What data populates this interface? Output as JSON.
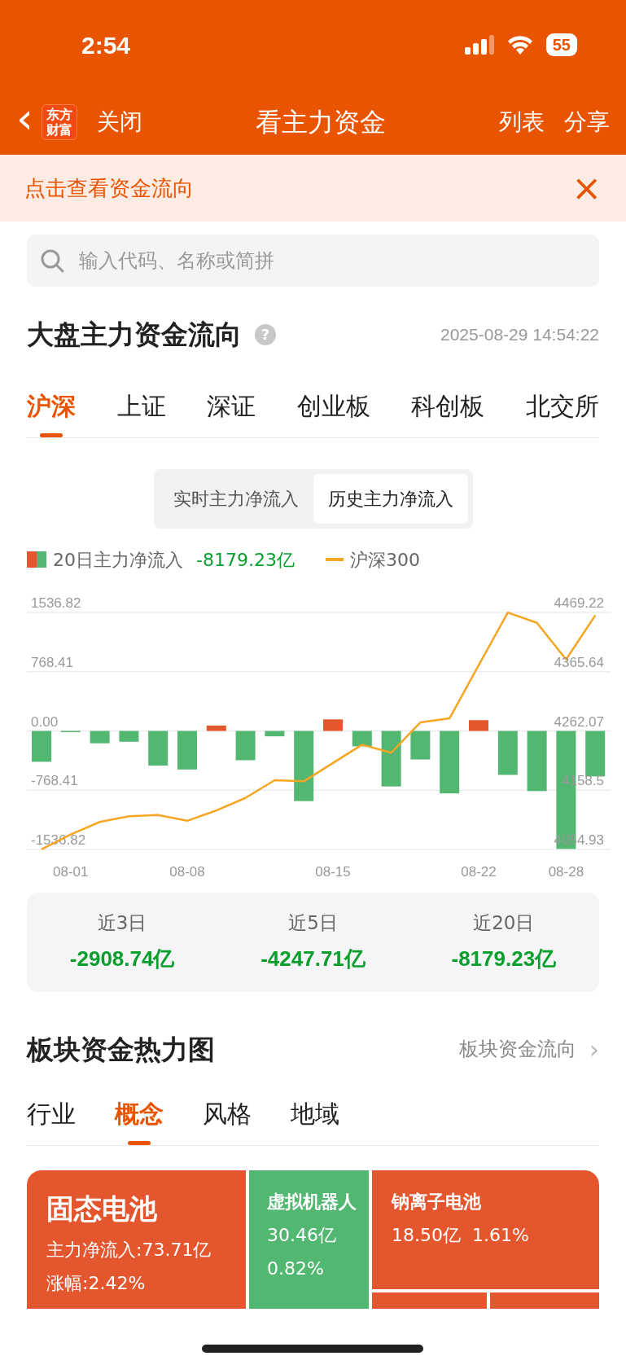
{
  "status_bar": {
    "time": "2:54",
    "battery": "55"
  },
  "nav": {
    "back": "‹",
    "logo": [
      "东方",
      "财富"
    ],
    "close": "关闭",
    "title": "看主力资金",
    "list": "列表",
    "share": "分享"
  },
  "banner": {
    "text": "点击查看资金流向",
    "close": "×"
  },
  "search": {
    "placeholder": "输入代码、名称或简拼"
  },
  "market_flow": {
    "title": "大盘主力资金流向",
    "help": "?",
    "timestamp": "2025-08-29 14:54:22",
    "tabs": [
      {
        "label": "沪深",
        "selected": true
      },
      {
        "label": "上证",
        "selected": false
      },
      {
        "label": "深证",
        "selected": false
      },
      {
        "label": "创业板",
        "selected": false
      },
      {
        "label": "科创板",
        "selected": false
      },
      {
        "label": "北交所",
        "selected": false
      }
    ],
    "modes": [
      {
        "label": "实时主力净流入",
        "selected": false
      },
      {
        "label": "历史主力净流入",
        "selected": true
      }
    ],
    "legend": {
      "bars_value": "-8179.23亿"
    },
    "chart_data": {
      "type": "bar",
      "grid": true,
      "categories": [
        null,
        "08-01",
        null,
        null,
        null,
        "08-08",
        null,
        null,
        null,
        null,
        "08-15",
        null,
        null,
        null,
        null,
        "08-22",
        null,
        null,
        "08-28",
        null
      ],
      "series": [
        {
          "name": "20日主力净流入",
          "values": [
            -400,
            -10,
            -160,
            -140,
            -450,
            -500,
            70,
            -380,
            -70,
            -910,
            150,
            -200,
            -720,
            -370,
            -810,
            140,
            -570,
            -780,
            -1530,
            -590
          ]
        }
      ],
      "ylim": [
        -1536.82,
        1536.82
      ],
      "yticks": [
        {
          "value": 1536.82,
          "label": "1536.82"
        },
        {
          "value": 768.41,
          "label": "768.41"
        },
        {
          "value": 0,
          "label": "0.00"
        },
        {
          "value": -768.41,
          "label": "-768.41"
        },
        {
          "value": -1536.82,
          "label": "-1536.82"
        }
      ]
    },
    "index_overlay": {
      "chart_data": {
        "type": "line",
        "categories": [
          null,
          null,
          null,
          null,
          null,
          null,
          null,
          null,
          null,
          null,
          null,
          null,
          null,
          null,
          null,
          null,
          null,
          null,
          null,
          null
        ],
        "series": [
          {
            "name": "沪深300",
            "color": "#f5a623",
            "values": [
              4055,
              4081,
              4103,
              4113,
              4115,
              4105,
              4123,
              4145,
              4176,
              4174,
              4206,
              4238,
              4224,
              4277,
              4284,
              4377,
              4469,
              4451,
              4387,
              4464
            ]
          }
        ],
        "ylim": [
          4054.93,
          4469.22
        ],
        "yticks": [
          {
            "value": 4469.22,
            "label": "4469.22"
          },
          {
            "value": 4365.64,
            "label": "4365.64"
          },
          {
            "value": 4262.07,
            "label": "4262.07"
          },
          {
            "value": 4158.5,
            "label": "4158.5"
          },
          {
            "value": 4054.93,
            "label": "4054.93"
          }
        ]
      }
    },
    "summary": [
      {
        "label": "近3日",
        "value": "-2908.74亿"
      },
      {
        "label": "近5日",
        "value": "-4247.71亿"
      },
      {
        "label": "近20日",
        "value": "-8179.23亿"
      }
    ]
  },
  "heatmap": {
    "title": "板块资金热力图",
    "link": "板块资金流向",
    "chevron": "›",
    "tabs": [
      {
        "label": "行业",
        "selected": false
      },
      {
        "label": "概念",
        "selected": true
      },
      {
        "label": "风格",
        "selected": false
      },
      {
        "label": "地域",
        "selected": false
      }
    ],
    "tiles": [
      {
        "name": "固态电池",
        "lines": [
          "主力净流入:73.71亿",
          "涨幅:2.42%"
        ],
        "color": "#e4572e"
      },
      {
        "name": "虚拟机器人",
        "lines": [
          "30.46亿",
          "0.82%"
        ],
        "color": "#52b771"
      },
      {
        "name": "钠离子电池",
        "lines": [
          "18.50亿  1.61%"
        ],
        "color": "#e4572e"
      },
      {
        "color": "#e4572e"
      },
      {
        "color": "#e4572e"
      }
    ]
  }
}
